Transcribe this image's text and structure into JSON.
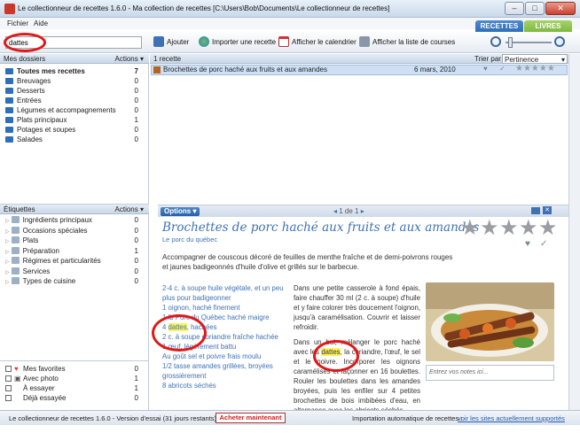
{
  "window": {
    "title": "Le collectionneur de recettes 1.6.0 - Ma collection de recettes [C:\\Users\\Bob\\Documents\\Le collectionneur de recettes]"
  },
  "menu": {
    "file": "Fichier",
    "help": "Aide"
  },
  "tabs": {
    "recipes": "RECETTES",
    "books": "LIVRES"
  },
  "search": {
    "value": "dattes"
  },
  "toolbar": {
    "add": "Ajouter",
    "import": "Importer une recette",
    "calendar": "Afficher le calendrier",
    "shopping": "Afficher la liste de courses"
  },
  "folders": {
    "header": "Mes dossiers",
    "actions": "Actions",
    "items": [
      {
        "label": "Toutes mes recettes",
        "count": "7"
      },
      {
        "label": "Breuvages",
        "count": "0"
      },
      {
        "label": "Desserts",
        "count": "0"
      },
      {
        "label": "Entrées",
        "count": "0"
      },
      {
        "label": "Légumes et accompagnements",
        "count": "0"
      },
      {
        "label": "Plats principaux",
        "count": "1"
      },
      {
        "label": "Potages et soupes",
        "count": "0"
      },
      {
        "label": "Salades",
        "count": "0"
      }
    ]
  },
  "tags": {
    "header": "Étiquettes",
    "actions": "Actions",
    "items": [
      {
        "label": "Ingrédients principaux",
        "count": "0"
      },
      {
        "label": "Occasions spéciales",
        "count": "0"
      },
      {
        "label": "Plats",
        "count": "0"
      },
      {
        "label": "Préparation",
        "count": "1"
      },
      {
        "label": "Régimes et particularités",
        "count": "0"
      },
      {
        "label": "Services",
        "count": "0"
      },
      {
        "label": "Types de cuisine",
        "count": "0"
      }
    ]
  },
  "filters": [
    {
      "label": "Mes favorites",
      "count": "0"
    },
    {
      "label": "Avec photo",
      "count": "1"
    },
    {
      "label": "À essayer",
      "count": "1"
    },
    {
      "label": "Déjà essayée",
      "count": "0"
    }
  ],
  "list": {
    "count_label": "1 recette",
    "sort_label": "Trier par :",
    "sort_value": "Pertinence",
    "row": {
      "title": "Brochettes de porc haché aux fruits et aux amandes",
      "date": "6 mars, 2010"
    }
  },
  "detail": {
    "options": "Options",
    "pager": "1 de 1",
    "title": "Brochettes de porc haché aux fruits et aux amandes",
    "source": "Le porc du québec",
    "description": "Accompagner de couscous décoré de feuilles de menthe fraîche et de demi-poivrons rouges et jaunes badigeonnés d'huile d'olive et grillés sur le barbecue.",
    "ingredients": [
      "2-4 c. à soupe huile végétale, et un peu plus pour badigeonner",
      "1 oignon, haché finement",
      "1 lb Porc du Québec haché maigre",
      "4 dattes, hachées",
      "2 c. à soupe coriandre fraîche hachée",
      "1 œuf, légèrement battu",
      "Au goût sel et poivre frais moulu",
      "1/2 tasse amandes grillées, broyées grossièrement",
      "8 abricots séchés"
    ],
    "instructions_a": "Dans une petite casserole à fond épais, faire chauffer 30 ml (2 c. à soupe) d'huile et y faire colorer très doucement l'oignon, jusqu'à caramélisation. Couvrir et laisser refroidir.",
    "instructions_b": "Dans un bol, mélanger le porc haché avec les ",
    "instructions_hl": "dattes",
    "instructions_c": ", la coriandre, l'œuf, le sel et le poivre. Incorporer les oignons caramélisés et façonner en 16 boulettes. Rouler les boulettes dans les amandes broyées, puis les enfiler sur 4 petites brochettes de bois imbibées d'eau, en alternance avec les abricots séchés.",
    "notes_placeholder": "Entrez vos notes ici..."
  },
  "status": {
    "left": "Le collectionneur de recettes 1.6.0 - Version d'essai (31 jours restants)",
    "buy": "Acheter maintenant",
    "import_label": "Importation automatique de recettes :",
    "import_link": "voir les sites actuellement supportés"
  },
  "colors": {
    "accent": "#3f72b5",
    "highlight": "#fff35a",
    "annotation": "#e01818",
    "recipes_tab": "#2f6fb7",
    "books_tab": "#7fb83e"
  },
  "icons": [
    "app-icon",
    "add-icon",
    "import-icon",
    "calendar-icon",
    "shopping-list-icon",
    "zoom-out-icon",
    "zoom-in-icon",
    "folder-icon",
    "tag-icon",
    "heart-icon",
    "camera-icon",
    "star-icon"
  ]
}
